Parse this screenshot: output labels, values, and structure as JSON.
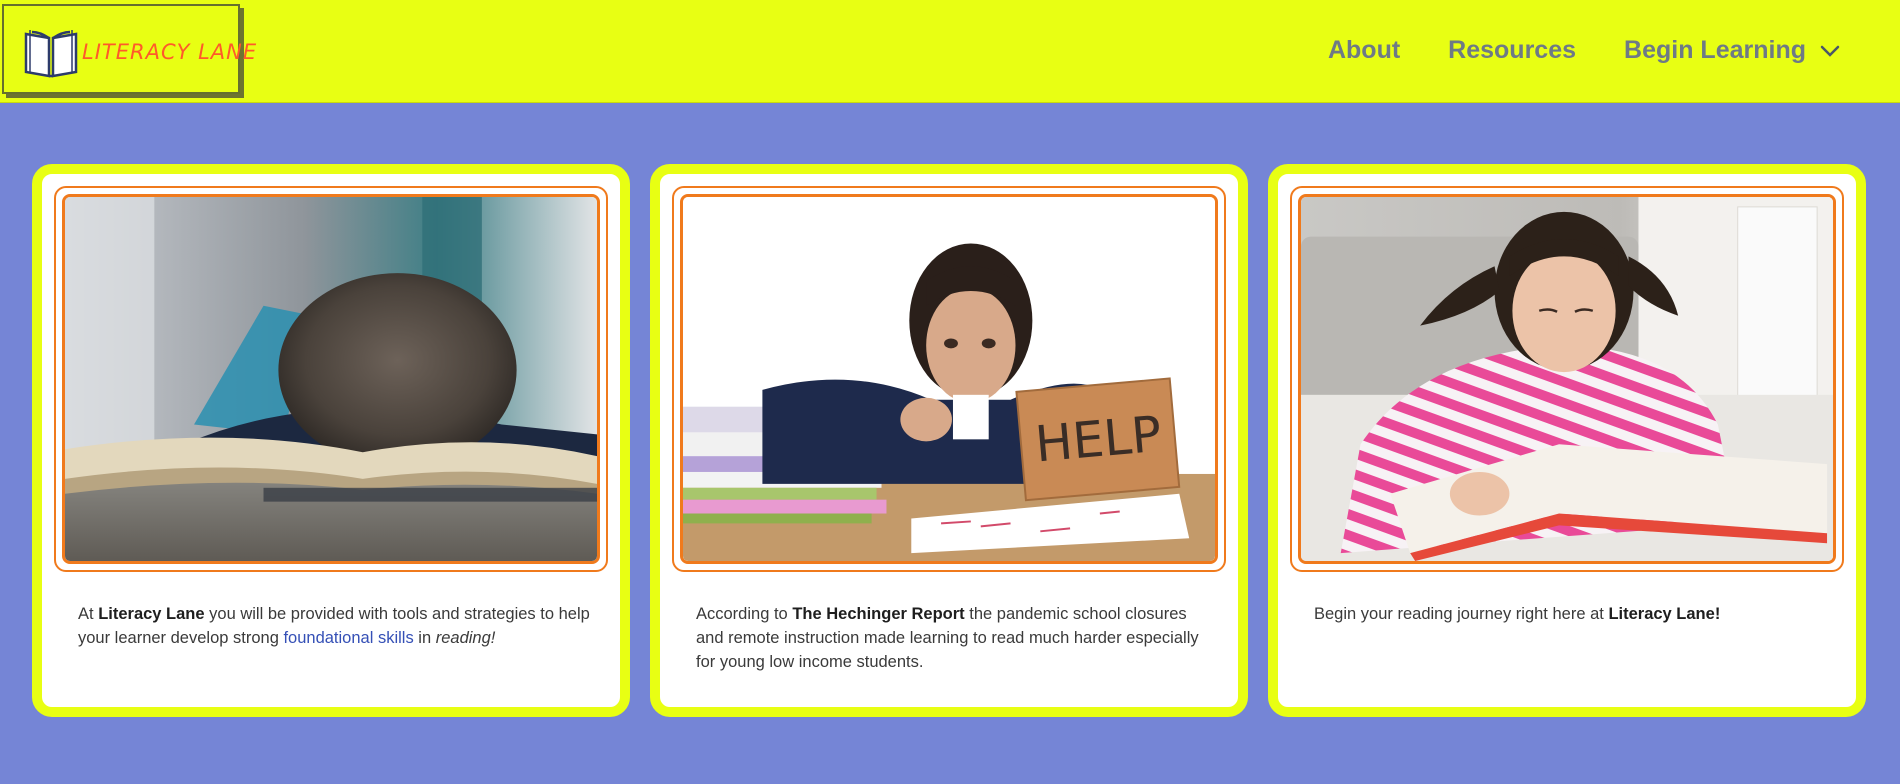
{
  "brand": {
    "name": "LITERACY LANE",
    "icon": "open-book-icon",
    "header_bg": "#e8ff13",
    "accent": "#f07a1c",
    "page_bg": "#7585d6"
  },
  "nav": {
    "about": "About",
    "resources": "Resources",
    "begin_learning": "Begin Learning",
    "dropdown_icon": "chevron-down-icon"
  },
  "cards": [
    {
      "image": "boy-asleep-on-book-photo",
      "text": {
        "prefix": "At ",
        "strong": "Literacy Lane",
        "middle": " you will be provided with tools and strategies to help your learner develop strong ",
        "link": "foundational skills",
        "after_link": " in ",
        "em": "reading!"
      }
    },
    {
      "image": "girl-holding-help-sign-photo",
      "help_sign": "HELP",
      "text": {
        "prefix": "According to ",
        "strong": "The Hechinger Report",
        "suffix": " the pandemic school closures and remote instruction made learning to read much harder especially for young low income students."
      }
    },
    {
      "image": "girl-reading-book-photo",
      "text": {
        "prefix": "Begin your reading journey right here at ",
        "strong": "Literacy Lane!"
      }
    }
  ]
}
